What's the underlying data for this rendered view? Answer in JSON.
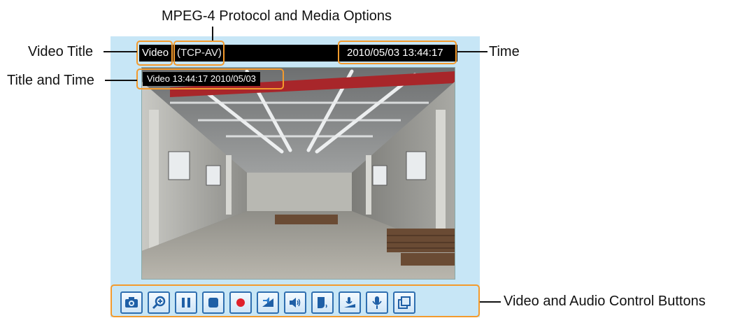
{
  "callouts": {
    "protocol": "MPEG-4 Protocol and Media Options",
    "video_title": "Video Title",
    "title_and_time": "Title and Time",
    "time": "Time",
    "controls": "Video and Audio Control Buttons"
  },
  "titlebar": {
    "video_title": "Video",
    "protocol": "(TCP-AV)",
    "time": "2010/05/03 13:44:17"
  },
  "osd": {
    "text": "Video 13:44:17  2010/05/03"
  },
  "controls": [
    {
      "name": "snapshot-button",
      "icon": "camera-icon"
    },
    {
      "name": "digital-zoom-button",
      "icon": "zoom-in-icon"
    },
    {
      "name": "pause-button",
      "icon": "pause-icon"
    },
    {
      "name": "stop-button",
      "icon": "stop-icon"
    },
    {
      "name": "record-button",
      "icon": "record-icon"
    },
    {
      "name": "volume-button",
      "icon": "volume-icon"
    },
    {
      "name": "mute-button",
      "icon": "speaker-icon"
    },
    {
      "name": "talk-button",
      "icon": "talk-icon"
    },
    {
      "name": "mic-volume-button",
      "icon": "mic-volume-icon"
    },
    {
      "name": "mic-button",
      "icon": "microphone-icon"
    },
    {
      "name": "fullscreen-button",
      "icon": "fullscreen-icon"
    }
  ],
  "colors": {
    "highlight": "#f39a2c",
    "panel": "#c7e6f6",
    "button_border": "#2f6fb0",
    "record_red": "#e0202a"
  }
}
